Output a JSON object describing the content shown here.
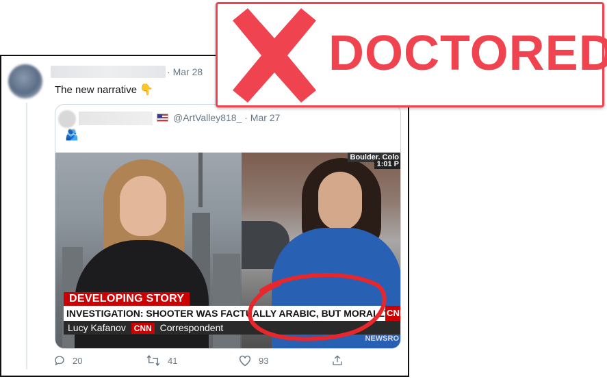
{
  "tweet": {
    "date": "Mar 28",
    "text": "The new narrative",
    "emoji_icon": "backhand-index-pointing-down",
    "quoted": {
      "handle_date": "@ArtValley818_ · Mar 27",
      "flag_icon": "us-flag",
      "emoji_icon": "person-raising-hand",
      "media": {
        "corner_location": "Boulder, Colo",
        "time": "1:01 P",
        "banner_label": "DEVELOPING STORY",
        "headline": "INVESTIGATION: SHOOTER WAS FACTUALLY ARABIC, BUT MORALLY WHITE",
        "reporter_name": "Lucy Kafanov",
        "network_logo": "CNN",
        "reporter_title": "Correspondent",
        "right_logo": "CNN",
        "ticker": "NEWSRO"
      }
    },
    "actions": {
      "replies": "20",
      "retweets": "41",
      "likes": "93"
    }
  },
  "stamp": {
    "label": "DOCTORED",
    "color": "#ef4450"
  }
}
